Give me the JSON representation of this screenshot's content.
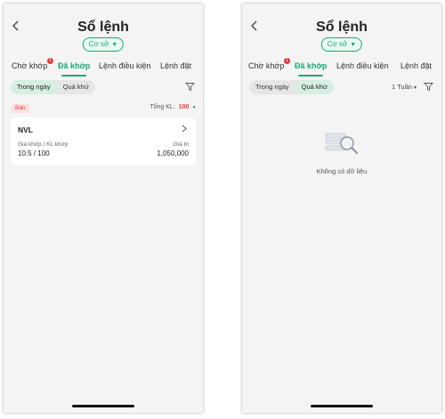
{
  "colors": {
    "accent": "#19a872",
    "sell": "#e23b3b",
    "background": "#f4f4f4"
  },
  "left": {
    "header": {
      "title": "Sổ lệnh",
      "account": "Cơ sở"
    },
    "tabs": [
      {
        "label": "Chờ khớp",
        "badge": "1"
      },
      {
        "label": "Đã khớp",
        "active": true
      },
      {
        "label": "Lệnh điều kiện"
      },
      {
        "label": "Lệnh đặt"
      }
    ],
    "filter": {
      "options": [
        "Trong ngày",
        "Quá khứ"
      ],
      "selected": "Trong ngày"
    },
    "summary": {
      "side": "Bán",
      "total_label": "Tổng KL:",
      "total_value": "100"
    },
    "orders": [
      {
        "symbol": "NVL",
        "price_label": "Giá khớp / KL khớp",
        "price_value": "10.5 / 100",
        "value_label": "Giá trị",
        "value": "1,050,000"
      }
    ]
  },
  "right": {
    "header": {
      "title": "Sổ lệnh",
      "account": "Cơ sở"
    },
    "tabs": [
      {
        "label": "Chờ khớp",
        "badge": "1"
      },
      {
        "label": "Đã khớp",
        "active": true
      },
      {
        "label": "Lệnh điều kiện"
      },
      {
        "label": "Lệnh đặt"
      }
    ],
    "filter": {
      "options": [
        "Trong ngày",
        "Quá khứ"
      ],
      "selected": "Quá khứ"
    },
    "period": "1 Tuần",
    "empty_text": "Không có dữ liệu"
  }
}
